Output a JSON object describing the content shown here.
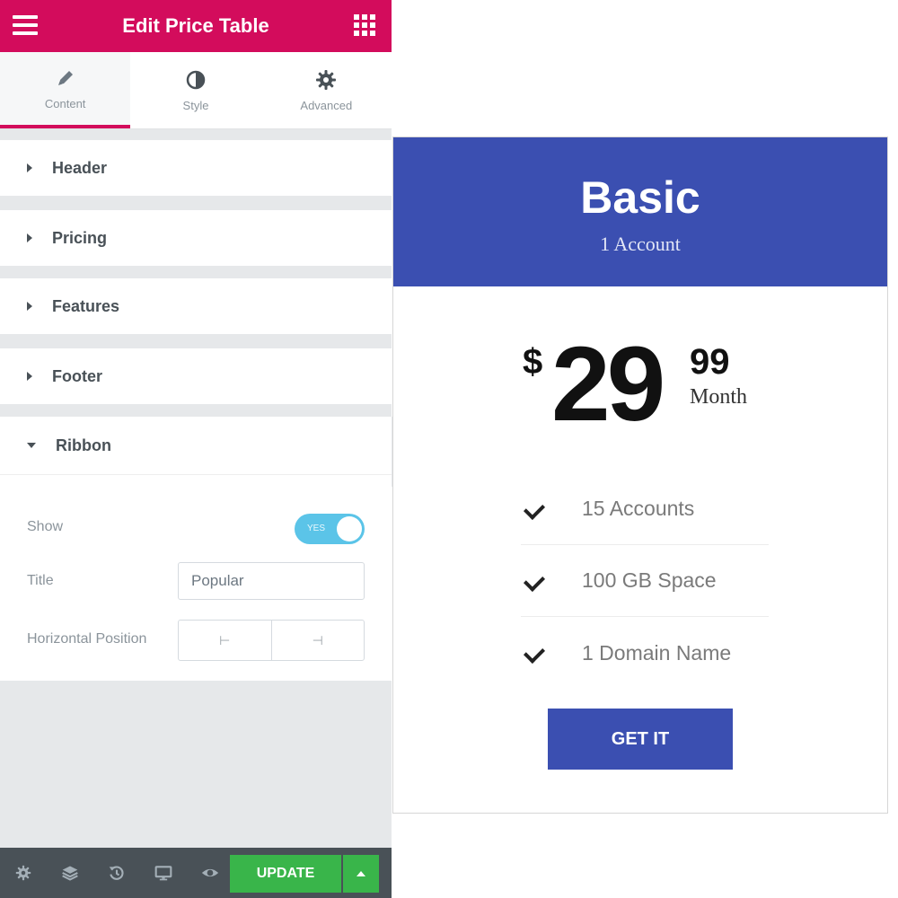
{
  "editor": {
    "title": "Edit Price Table",
    "tabs": [
      {
        "label": "Content",
        "icon": "pencil-icon"
      },
      {
        "label": "Style",
        "icon": "half-circle-icon"
      },
      {
        "label": "Advanced",
        "icon": "gear-icon"
      }
    ],
    "sections": [
      {
        "title": "Header"
      },
      {
        "title": "Pricing"
      },
      {
        "title": "Features"
      },
      {
        "title": "Footer"
      },
      {
        "title": "Ribbon"
      }
    ],
    "ribbon": {
      "show_label": "Show",
      "toggle_text": "YES",
      "title_label": "Title",
      "title_value": "Popular",
      "position_label": "Horizontal Position",
      "position_left_glyph": "⊢",
      "position_right_glyph": "⊣"
    },
    "footer": {
      "update_label": "UPDATE"
    }
  },
  "colors": {
    "brand": "#d30c5c",
    "table_blue": "#3b4fb1",
    "update_green": "#39b54a",
    "toggle_blue": "#5bc4e8"
  },
  "price_table": {
    "heading": "Basic",
    "subheading": "1 Account",
    "currency": "$",
    "price_integer": "29",
    "price_fraction": "99",
    "period": "Month",
    "features": [
      {
        "text": "15 Accounts"
      },
      {
        "text": "100 GB Space"
      },
      {
        "text": "1 Domain Name"
      }
    ],
    "button_label": "GET IT"
  }
}
